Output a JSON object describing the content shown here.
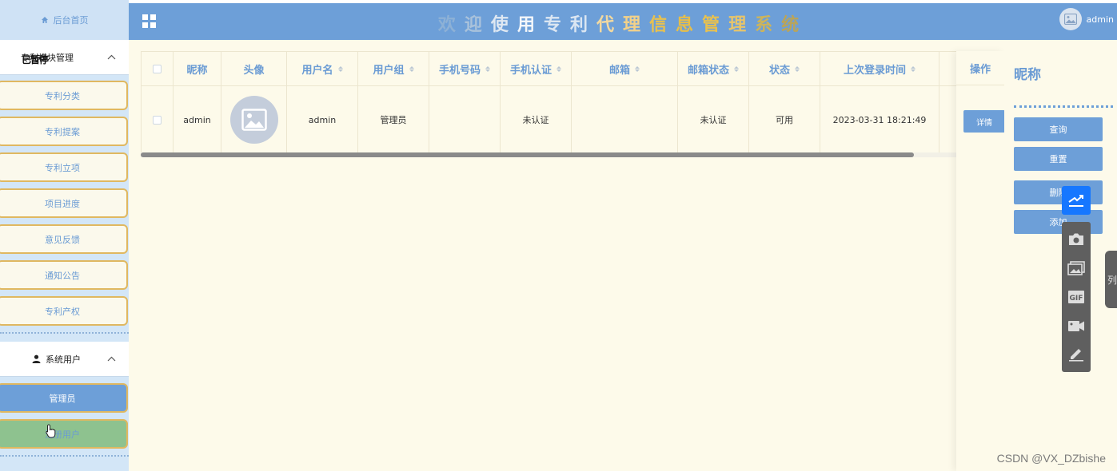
{
  "sidebar": {
    "home_label": "后台首页",
    "group1_label": "专利模块管理",
    "overlay_tag": "已暂停",
    "items": [
      {
        "label": "专利分类"
      },
      {
        "label": "专利提案"
      },
      {
        "label": "专利立项"
      },
      {
        "label": "项目进度"
      },
      {
        "label": "意见反馈"
      },
      {
        "label": "通知公告"
      },
      {
        "label": "专利产权"
      }
    ],
    "group2_label": "系统用户",
    "user_items": [
      {
        "label": "管理员"
      },
      {
        "label": "注册用户"
      }
    ]
  },
  "header": {
    "title_chars": [
      "欢",
      "迎",
      "使",
      "用",
      "专",
      "利",
      "代",
      "理",
      "信",
      "息",
      "管",
      "理",
      "系",
      "统"
    ],
    "title_colors": [
      "#8db1d6",
      "#a9c2db",
      "#dfe8f2",
      "#f3f6fa",
      "#dbe6f2",
      "#dbe6f2",
      "#f2d9a0",
      "#f2d18a",
      "#e8c14f",
      "#e6be4a",
      "#e8c14f",
      "#e6c46b",
      "#cdb45a",
      "#b9a45a"
    ],
    "username": "admin"
  },
  "table": {
    "columns": [
      {
        "label": "",
        "sortable": false
      },
      {
        "label": "昵称",
        "sortable": false
      },
      {
        "label": "头像",
        "sortable": false
      },
      {
        "label": "用户名",
        "sortable": true
      },
      {
        "label": "用户组",
        "sortable": true
      },
      {
        "label": "手机号码",
        "sortable": true
      },
      {
        "label": "手机认证",
        "sortable": true
      },
      {
        "label": "邮箱",
        "sortable": true
      },
      {
        "label": "邮箱状态",
        "sortable": true
      },
      {
        "label": "状态",
        "sortable": true
      },
      {
        "label": "上次登录时间",
        "sortable": true
      }
    ],
    "rows": [
      {
        "nickname": "admin",
        "username": "admin",
        "group": "管理员",
        "phone": "",
        "phone_verified": "未认证",
        "email": "",
        "email_status": "未认证",
        "status": "可用",
        "last_login": "2023-03-31 18:21:49"
      }
    ],
    "op_header": "操作",
    "op_button": "详情"
  },
  "search": {
    "label": "昵称",
    "query_button": "查询",
    "reset_button": "重置",
    "delete_button": "删除",
    "add_button": "添加"
  },
  "float": {
    "side_tab_text": "列"
  },
  "watermark": "CSDN @VX_DZbishe",
  "colors": {
    "primary": "#6d9fd8",
    "content_bg": "#fdfaea",
    "sidebar_bg": "#d3e6f7",
    "item_border": "#e0b860",
    "green": "#8ec28f"
  }
}
